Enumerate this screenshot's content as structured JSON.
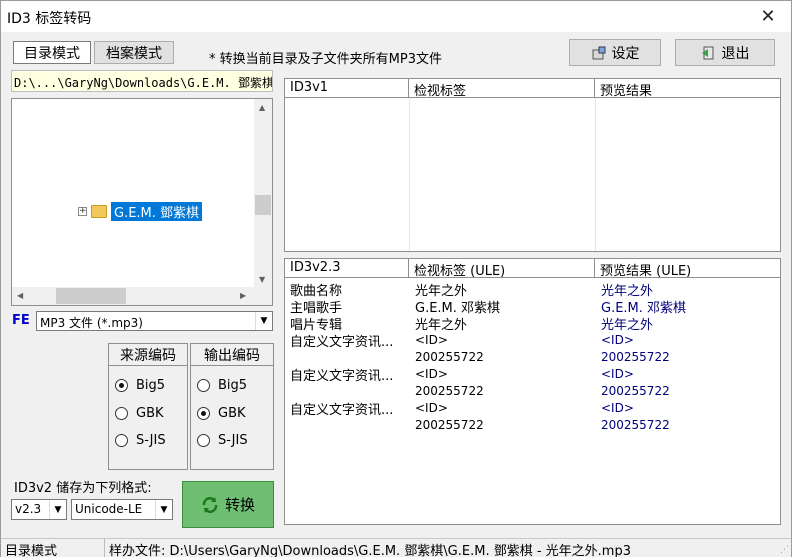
{
  "window": {
    "title": "ID3 标签转码",
    "close_glyph": "✕"
  },
  "mode_tabs": {
    "dir_mode": "目录模式",
    "file_mode": "档案模式"
  },
  "note": "* 转换当前目录及子文件夹所有MP3文件",
  "buttons": {
    "settings": "设定",
    "exit": "退出",
    "convert": "转换"
  },
  "path": "D:\\...\\GaryNg\\Downloads\\G.E.M. 鄧紫棋",
  "tree": {
    "selected_node": "G.E.M. 鄧紫棋"
  },
  "filter": {
    "fe_label": "FE",
    "selected": "MP3 文件 (*.mp3)"
  },
  "source_encoding": {
    "title": "来源编码",
    "options": [
      "Big5",
      "GBK",
      "S-JIS"
    ],
    "selected": "Big5"
  },
  "output_encoding": {
    "title": "输出编码",
    "options": [
      "Big5",
      "GBK",
      "S-JIS"
    ],
    "selected": "GBK"
  },
  "save_format": {
    "label": "ID3v2 储存为下列格式:",
    "version": "v2.3",
    "encoding": "Unicode-LE"
  },
  "id3v1_table": {
    "headers": [
      "ID3v1",
      "检视标签",
      "预览结果"
    ],
    "rows": []
  },
  "id3v2_table": {
    "headers": [
      "ID3v2.3",
      "检视标签 (ULE)",
      "预览结果 (ULE)"
    ],
    "rows": [
      [
        "歌曲名称",
        "光年之外",
        "光年之外"
      ],
      [
        "主唱歌手",
        "G.E.M. 邓紫棋",
        "G.E.M. 邓紫棋"
      ],
      [
        "唱片专辑",
        "光年之外",
        "光年之外"
      ],
      [
        "自定义文字资讯...",
        "<ID>",
        "<ID>"
      ],
      [
        "",
        "200255722",
        "200255722"
      ],
      [
        "自定义文字资讯...",
        "<ID>",
        "<ID>"
      ],
      [
        "",
        "200255722",
        "200255722"
      ],
      [
        "自定义文字资讯...",
        "<ID>",
        "<ID>"
      ],
      [
        "",
        "200255722",
        "200255722"
      ]
    ]
  },
  "status": {
    "mode": "目录模式",
    "sample_file": "样办文件: D:\\Users\\GaryNg\\Downloads\\G.E.M. 鄧紫棋\\G.E.M. 鄧紫棋 - 光年之外.mp3"
  }
}
